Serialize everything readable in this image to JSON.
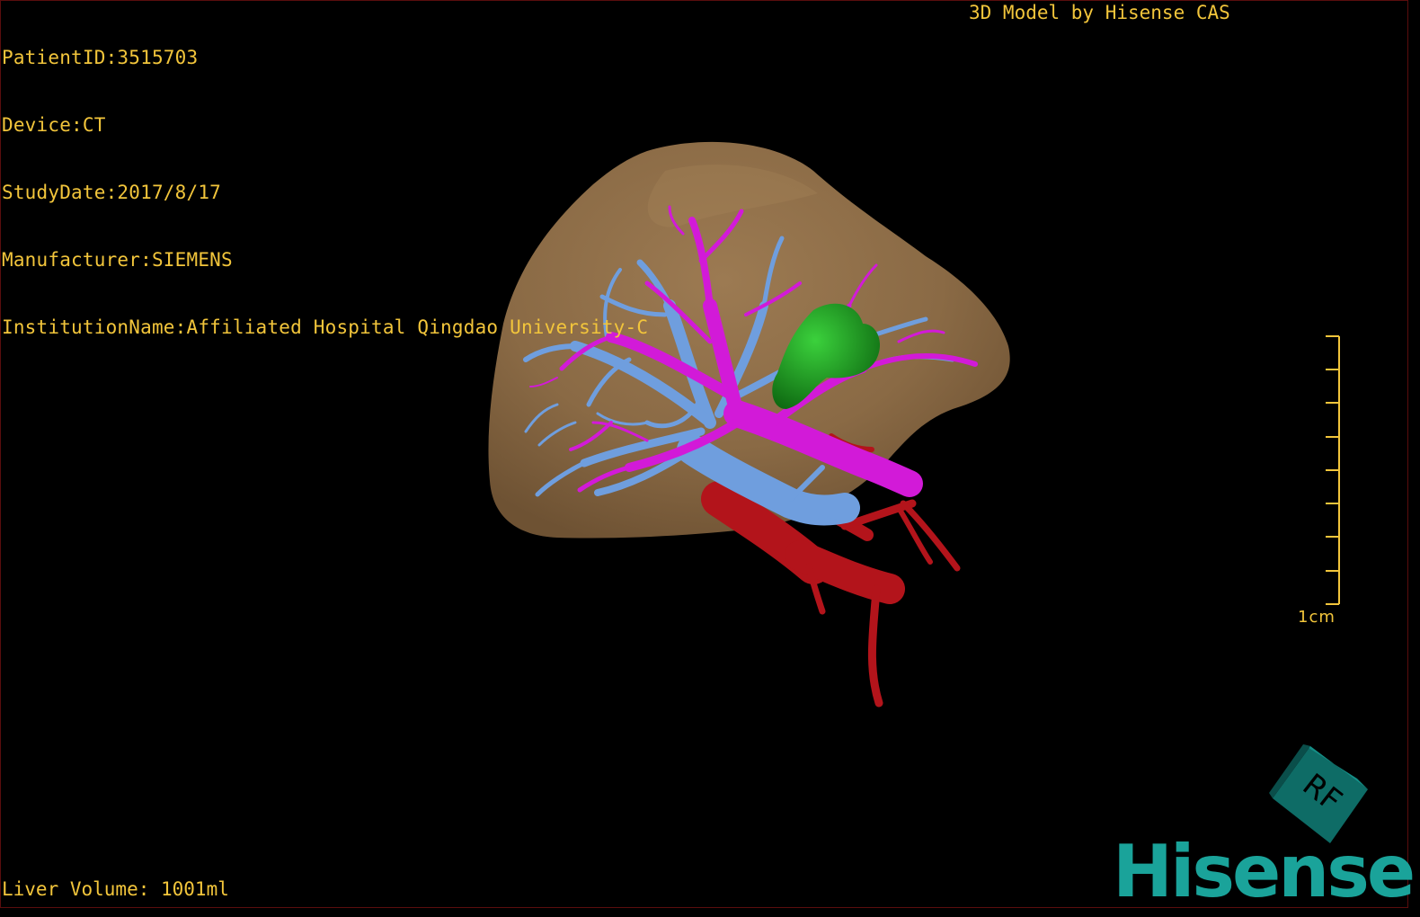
{
  "overlay": {
    "patient_id": "PatientID:3515703",
    "device": "Device:CT",
    "study_date": "StudyDate:2017/8/17",
    "manufacturer": "Manufacturer:SIEMENS",
    "institution": "InstitutionName:Affiliated Hospital Qingdao University-C",
    "title": "3D Model by Hisense CAS",
    "liver_volume": "Liver Volume: 1001ml"
  },
  "scale": {
    "label": "1cm"
  },
  "orientation_cube": {
    "face_text": "RF"
  },
  "brand": {
    "name": "Hisense"
  },
  "colors": {
    "overlay_text": "#f2c53b",
    "liver": "#8a6a45",
    "portal_vein": "#d21ad8",
    "hepatic_vein": "#6f9ede",
    "artery": "#b3141b",
    "tumor": "#1f9a22",
    "brand": "#1aa39a"
  },
  "structures": {
    "liver": "liver-surface",
    "portal_vein": "portal-vein",
    "hepatic_vein": "hepatic-vein",
    "artery": "hepatic-artery",
    "tumor": "lesion"
  }
}
